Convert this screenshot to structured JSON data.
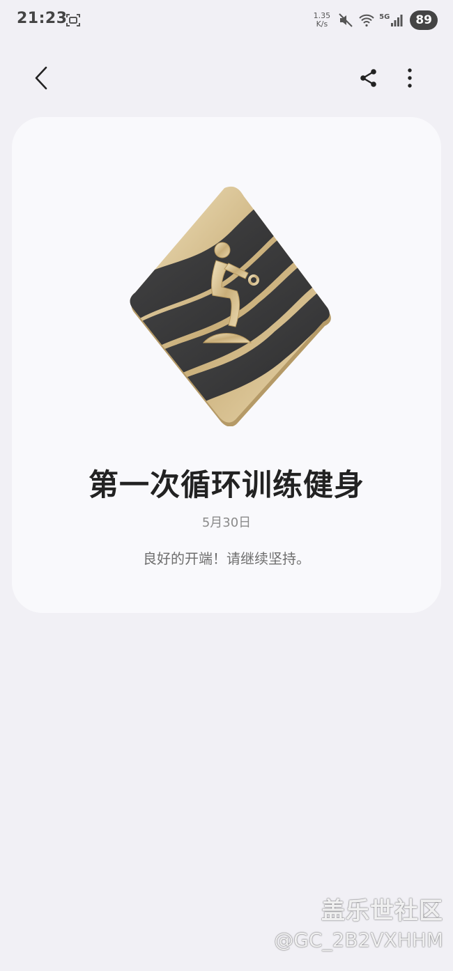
{
  "status_bar": {
    "time": "21:23",
    "net_speed_value": "1.35",
    "net_speed_unit": "K/s",
    "network_label": "5G",
    "battery": "89",
    "icons": [
      "screenshot-icon",
      "mute-icon",
      "wifi-icon",
      "cellular-signal-icon",
      "battery-icon"
    ]
  },
  "app_bar": {
    "icons": [
      "back-icon",
      "share-icon",
      "more-vert-icon"
    ]
  },
  "achievement": {
    "badge_icon": "circuit-training-badge",
    "title": "第一次循环训练健身",
    "date": "5月30日",
    "description": "良好的开端！请继续坚持。"
  },
  "watermark": {
    "brand": "盖乐世社区",
    "user": "@GC_2B2VXHHM"
  },
  "colors": {
    "background": "#f1f0f5",
    "card": "#f9f9fc",
    "badge_gold": "#d8c39a",
    "badge_dark": "#3a3a3b"
  }
}
